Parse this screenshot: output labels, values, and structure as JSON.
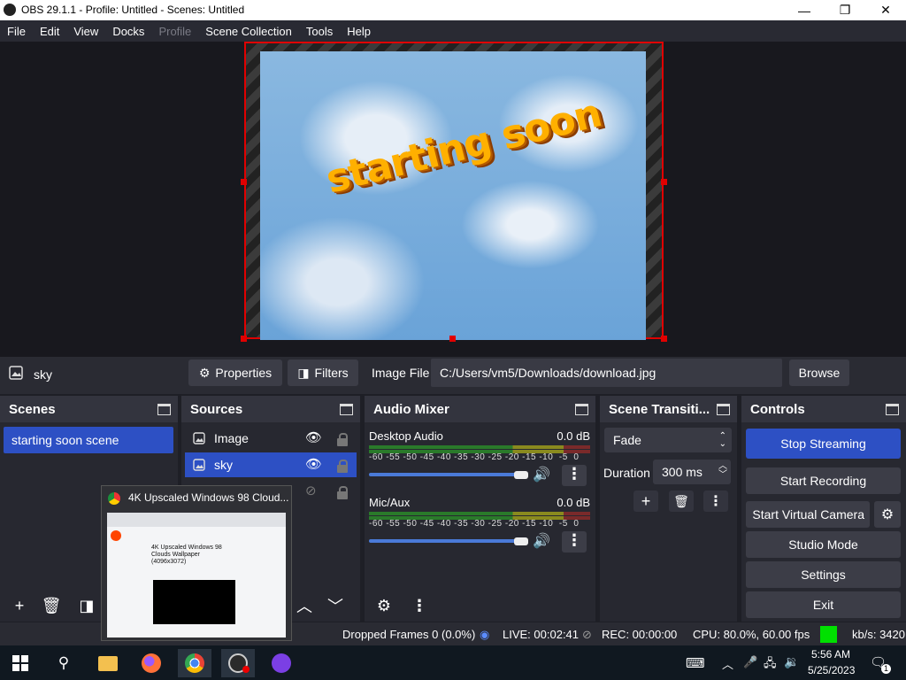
{
  "window": {
    "title": "OBS 29.1.1 - Profile: Untitled - Scenes: Untitled",
    "minimize": "—",
    "maximize": "❐",
    "close": "✕"
  },
  "menu": [
    "File",
    "Edit",
    "View",
    "Docks",
    "Profile",
    "Scene Collection",
    "Tools",
    "Help"
  ],
  "preview": {
    "text": "starting soon"
  },
  "source_bar": {
    "source_name": "sky",
    "properties": "Properties",
    "filters": "Filters",
    "image_file_label": "Image File",
    "image_path": "C:/Users/vm5/Downloads/download.jpg",
    "browse": "Browse"
  },
  "scenes": {
    "title": "Scenes",
    "items": [
      "starting soon scene"
    ]
  },
  "sources": {
    "title": "Sources",
    "items": [
      "Image",
      "sky"
    ]
  },
  "audio_mixer": {
    "title": "Audio Mixer",
    "channels": [
      {
        "name": "Desktop Audio",
        "level": "0.0 dB",
        "volume": 1.0
      },
      {
        "name": "Mic/Aux",
        "level": "0.0 dB",
        "volume": 1.0
      }
    ],
    "scale": [
      "-60",
      "-55",
      "-50",
      "-45",
      "-40",
      "-35",
      "-30",
      "-25",
      "-20",
      "-15",
      "-10",
      "-5",
      "0"
    ]
  },
  "transitions": {
    "title": "Scene Transiti...",
    "selected": "Fade",
    "duration_label": "Duration",
    "duration_value": "300 ms"
  },
  "controls": {
    "title": "Controls",
    "stop_streaming": "Stop Streaming",
    "start_recording": "Start Recording",
    "start_virtual_camera": "Start Virtual Camera",
    "studio_mode": "Studio Mode",
    "settings": "Settings",
    "exit": "Exit"
  },
  "status": {
    "dropped_frames": "Dropped Frames 0 (0.0%)",
    "live": "LIVE: 00:02:41",
    "rec": "REC: 00:00:00",
    "cpu": "CPU: 80.0%, 60.00 fps",
    "kbs": "kb/s: 3420"
  },
  "thumbnail": {
    "title": "4K Upscaled Windows 98 Cloud...",
    "page_heading": "4K Upscaled Windows 98 Clouds Wallpaper (4096x3072)"
  },
  "taskbar": {
    "time": "5:56 AM",
    "date": "5/25/2023",
    "notification_count": "1"
  },
  "colors": {
    "accent": "#2d50c4",
    "live_indicator": "#00e000",
    "selection_border": "#e00000"
  }
}
